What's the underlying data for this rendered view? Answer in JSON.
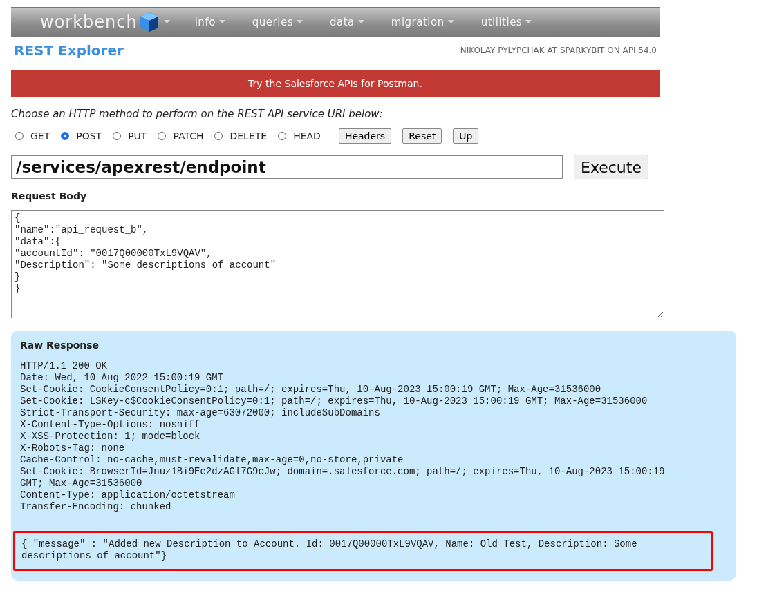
{
  "nav": {
    "logo": "workbench",
    "menus": [
      {
        "label": "info"
      },
      {
        "label": "queries"
      },
      {
        "label": "data"
      },
      {
        "label": "migration"
      },
      {
        "label": "utilities"
      }
    ]
  },
  "page_title": "REST Explorer",
  "user_info": "NIKOLAY PYLYPCHAK AT SPARKYBIT ON API 54.0",
  "banner": {
    "text_before": "Try the ",
    "link": "Salesforce APIs for Postman",
    "text_after": "."
  },
  "instructions": "Choose an HTTP method to perform on the REST API service URI below:",
  "methods": [
    {
      "label": "GET",
      "selected": false
    },
    {
      "label": "POST",
      "selected": true
    },
    {
      "label": "PUT",
      "selected": false
    },
    {
      "label": "PATCH",
      "selected": false
    },
    {
      "label": "DELETE",
      "selected": false
    },
    {
      "label": "HEAD",
      "selected": false
    }
  ],
  "method_buttons": [
    "Headers",
    "Reset",
    "Up"
  ],
  "uri": {
    "value": "/services/apexrest/endpoint"
  },
  "execute_button": "Execute",
  "request_body": {
    "label": "Request Body",
    "lines": [
      "{",
      "\"name\":\"api_request_b\",",
      "\"data\":{",
      "\"accountId\": \"0017Q00000TxL9VQAV\",",
      "\"Description\": \"Some descriptions of account\"",
      "}",
      "}"
    ]
  },
  "response": {
    "title": "Raw Response",
    "headers": [
      "HTTP/1.1 200 OK",
      "Date: Wed, 10 Aug 2022 15:00:19 GMT",
      "Set-Cookie: CookieConsentPolicy=0:1; path=/; expires=Thu, 10-Aug-2023 15:00:19 GMT; Max-Age=31536000",
      "Set-Cookie: LSKey-c$CookieConsentPolicy=0:1; path=/; expires=Thu, 10-Aug-2023 15:00:19 GMT; Max-Age=31536000",
      "Strict-Transport-Security: max-age=63072000; includeSubDomains",
      "X-Content-Type-Options: nosniff",
      "X-XSS-Protection: 1; mode=block",
      "X-Robots-Tag: none",
      "Cache-Control: no-cache,must-revalidate,max-age=0,no-store,private",
      "Set-Cookie: BrowserId=Jnuz1Bi9Ee2dzAGl7G9cJw; domain=.salesforce.com; path=/; expires=Thu, 10-Aug-2023 15:00:19",
      "GMT; Max-Age=31536000",
      "Content-Type: application/octetstream",
      "Transfer-Encoding: chunked"
    ],
    "body_lines": [
      "{ \"message\" : \"Added new Description to Account. Id: 0017Q00000TxL9VQAV, Name: Old Test, Description: Some",
      "descriptions of account\"}"
    ]
  }
}
